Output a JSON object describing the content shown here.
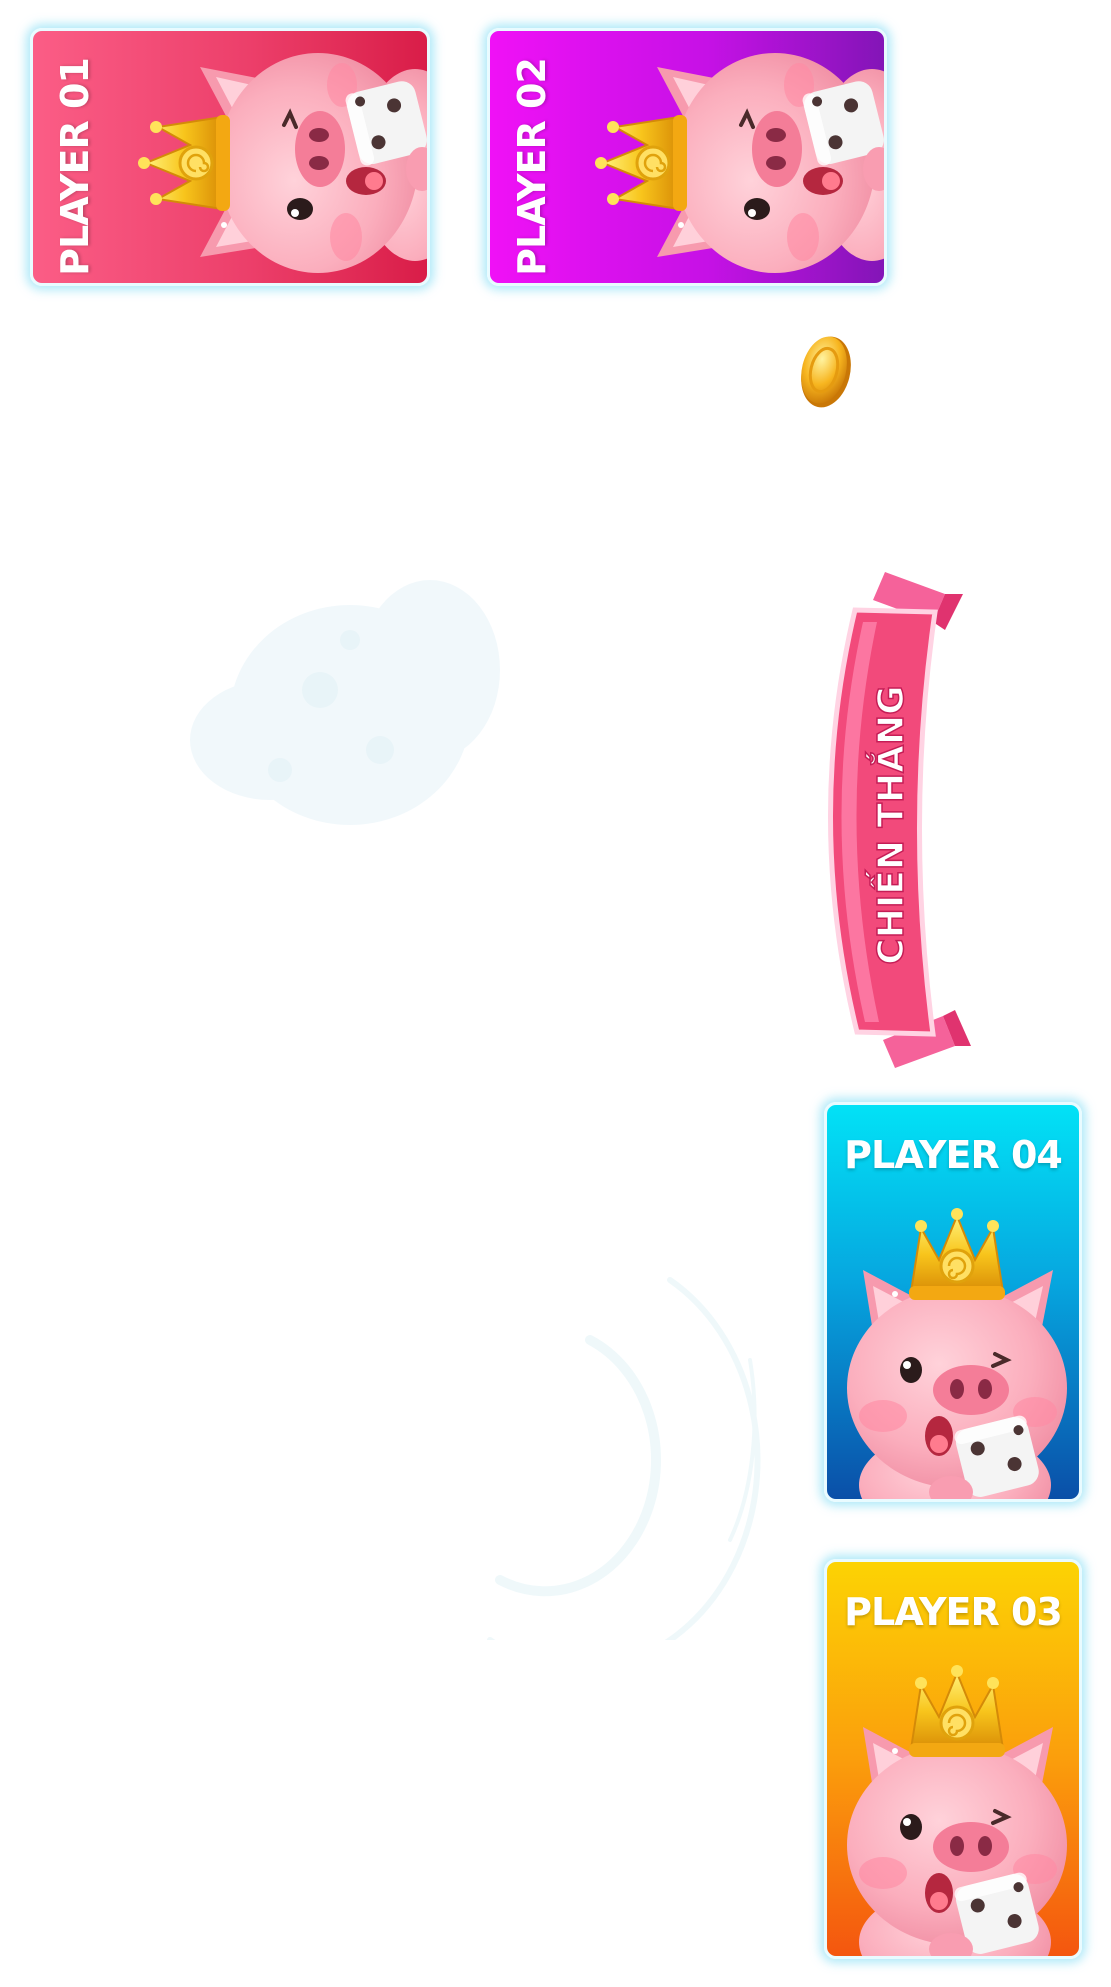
{
  "players": {
    "p1": {
      "label": "PLAYER 01",
      "color": "#ec3f6a"
    },
    "p2": {
      "label": "PLAYER 02",
      "color": "#c611e6"
    },
    "p4": {
      "label": "PLAYER 04",
      "color": "#06a6df"
    },
    "p3": {
      "label": "PLAYER 03",
      "color": "#fb9e0c"
    }
  },
  "banner": {
    "text": "CHIẾN THẮNG",
    "color": "#f0346b"
  },
  "icons": [
    "pig-king-icon",
    "crown-icon",
    "dice-icon",
    "gold-coin-icon",
    "ribbon-banner",
    "sparkle-burst",
    "swirl-effect"
  ]
}
